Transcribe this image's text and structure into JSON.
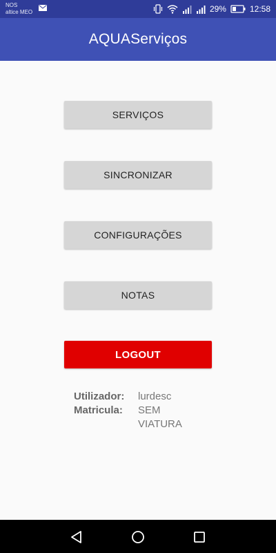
{
  "status_bar": {
    "carrier_line1": "NOS",
    "carrier_line2": "altice MEO",
    "battery": "29%",
    "time": "12:58",
    "icons": [
      "mail-icon",
      "vibrate-icon",
      "wifi-icon",
      "signal-icon",
      "signal-icon",
      "battery-icon"
    ]
  },
  "app_bar": {
    "title": "AQUAServiços",
    "color": "#3f51b5"
  },
  "menu": {
    "servicos": "SERVIÇOS",
    "sincronizar": "SINCRONIZAR",
    "configuracoes": "CONFIGURAÇÕES",
    "notas": "NOTAS",
    "logout": "LOGOUT",
    "logout_color": "#e00000"
  },
  "info": {
    "user_label": "Utilizador:",
    "user_value": "lurdesc",
    "plate_label": "Matricula:",
    "plate_value_line1": "SEM",
    "plate_value_line2": "VIATURA"
  },
  "nav_bar": {
    "icons": [
      "back-icon",
      "home-icon",
      "recent-apps-icon"
    ]
  }
}
